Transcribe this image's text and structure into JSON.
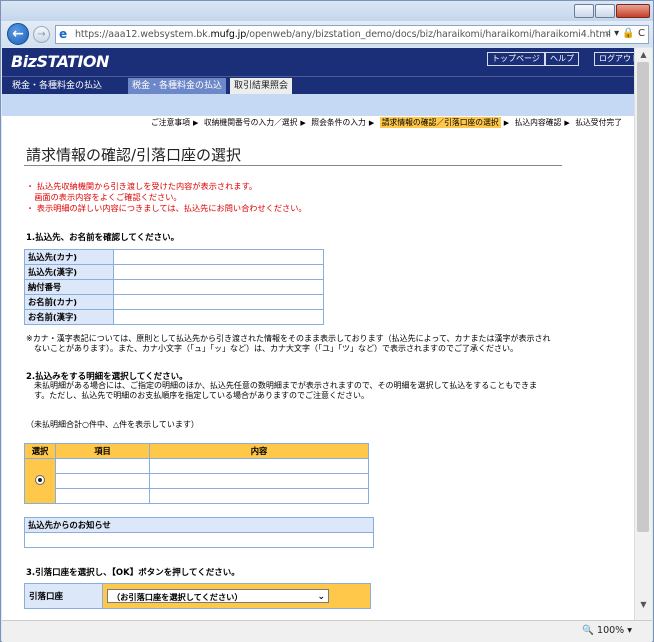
{
  "browser": {
    "url_prefix": "https://aaa12.websystem.bk.",
    "url_domain": "mufg.jp",
    "url_suffix": "/openweb/any/bizstation_demo/docs/biz/haraikomi/haraikomi/haraikomi4.html",
    "addr_tools": "⌕ ▾ 🔒 C",
    "zoom": "100%"
  },
  "header": {
    "logo": "BizSTATION",
    "links": [
      "トップページ",
      "ヘルプ",
      "ログアウト"
    ]
  },
  "tabs": [
    "税金・各種料金の払込",
    "税金・各種料金の払込",
    "取引結果照会"
  ],
  "steps": [
    "ご注意事項",
    "収納機関番号の入力／選択",
    "照会条件の入力",
    "請求情報の確認／引落口座の選択",
    "払込内容確認",
    "払込受付完了"
  ],
  "page": {
    "title": "請求情報の確認/引落口座の選択",
    "notes": [
      "・ 払込先収納機関から引き渡しを受けた内容が表示されます。",
      "　画面の表示内容をよくご確認ください。",
      "・ 表示明細の詳しい内容につきましては、払込先にお問い合わせください。"
    ],
    "section1": "1.払込先、お名前を確認してください。",
    "fields": [
      "払込先(カナ)",
      "払込先(漢字)",
      "納付番号",
      "お名前(カナ)",
      "お名前(漢字)"
    ],
    "kana_note_1": "※カナ・漢字表記については、原則として払込先から引き渡された情報をそのまま表示しております（払込先によって、カナまたは漢字が表示され",
    "kana_note_2": "　ないことがあります）。また、カナ小文字（「ュ」「ッ」など）は、カナ大文字（「ユ」「ツ」など）で表示されますのでご了承ください。",
    "section2": "2.払込みをする明細を選択してください。",
    "sec2_note_1": "　未払明細がある場合には、ご指定の明細のほか、払込先任意の数明細までが表示されますので、その明細を選択して払込をすることもできま",
    "sec2_note_2": "　す。ただし、払込先で明細のお支払順序を指定している場合がありますのでご注意ください。",
    "unpaid_note": "（未払明細合計○件中、△件を表示しています）",
    "col_select": "選択",
    "col_item": "項目",
    "col_content": "内容",
    "notice_label": "払込先からのお知らせ",
    "section3": "3.引落口座を選択し、【OK】ボタンを押してください。",
    "account_label": "引落口座",
    "account_select": "（お引落口座を選択してください）"
  }
}
